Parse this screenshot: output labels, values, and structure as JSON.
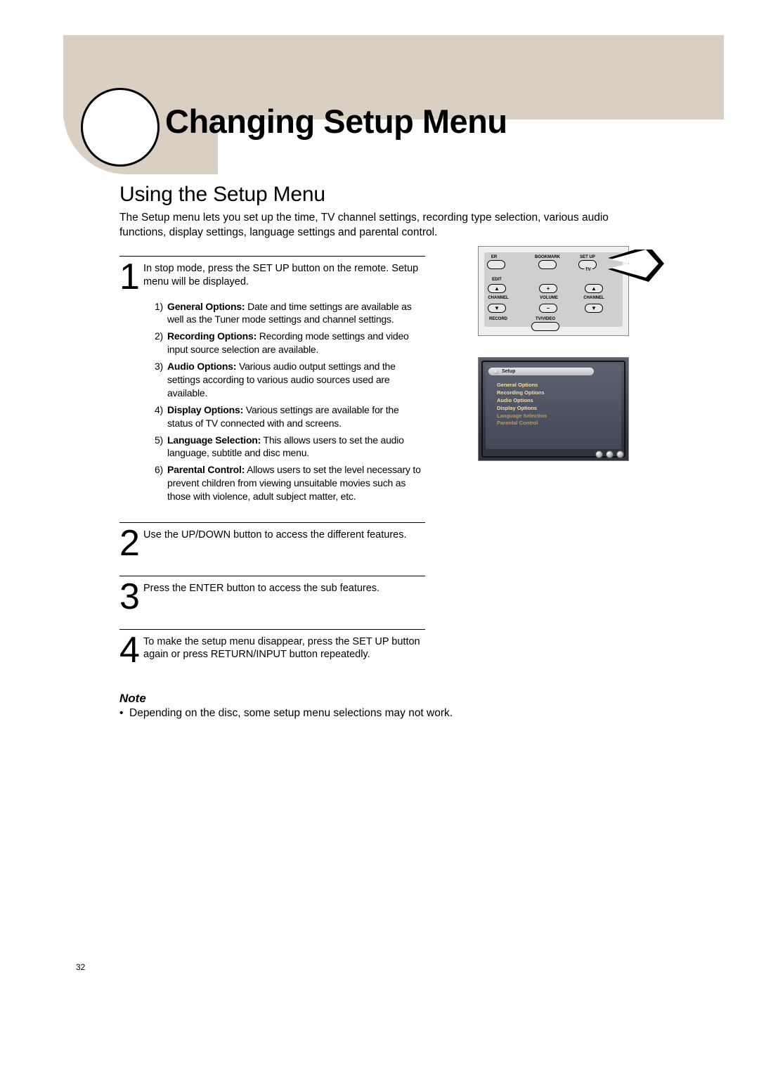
{
  "page_number": "32",
  "main_title": "Changing Setup Menu",
  "section_title": "Using the Setup Menu",
  "intro": "The Setup menu lets you set up the time, TV channel settings, recording type selection, various audio functions, display settings, language settings and parental control.",
  "steps": [
    {
      "num": "1",
      "text": "In stop mode, press the SET UP button on the remote. Setup menu will be displayed.",
      "sub": [
        {
          "n": "1)",
          "b": "General Options:",
          "t": " Date and time settings are available as well as the Tuner mode settings and channel settings."
        },
        {
          "n": "2)",
          "b": "Recording Options:",
          "t": " Recording mode settings and video input source selection are available."
        },
        {
          "n": "3)",
          "b": "Audio Options:",
          "t": " Various audio output settings and the settings according to various audio sources used are available."
        },
        {
          "n": "4)",
          "b": "Display Options:",
          "t": " Various settings are available for the status of TV connected with and screens."
        },
        {
          "n": "5)",
          "b": "Language Selection:",
          "t": " This allows users to set the audio language, subtitle and disc menu."
        },
        {
          "n": "6)",
          "b": "Parental Control:",
          "t": " Allows users to set the level necessary to prevent children from viewing unsuitable movies such as those with violence, adult subject matter, etc."
        }
      ]
    },
    {
      "num": "2",
      "text": "Use the UP/DOWN button to access the different features."
    },
    {
      "num": "3",
      "text": "Press the ENTER button to access the sub features."
    },
    {
      "num": "4",
      "text": "To make the setup menu disappear, press the SET UP button again or press RETURN/INPUT button repeatedly."
    }
  ],
  "note": {
    "heading": "Note",
    "text": "Depending on the disc, some setup menu selections may not work."
  },
  "remote": {
    "tv_label": "TV",
    "er": "ER",
    "bookmark": "BOOKMARK",
    "setup": "SET UP",
    "edit": "EDIT",
    "channel_l": "CHANNEL",
    "channel_r": "CHANNEL",
    "volume": "VOLUME",
    "record": "RECORD",
    "tvvideo": "TV/VIDEO",
    "plus": "+",
    "minus": "–",
    "up": "▲",
    "down": "▼"
  },
  "osd": {
    "title": "Setup",
    "items": [
      "General Options",
      "Recording Options",
      "Audio Options",
      "Display Options",
      "Language Selection",
      "Parental Control"
    ]
  }
}
